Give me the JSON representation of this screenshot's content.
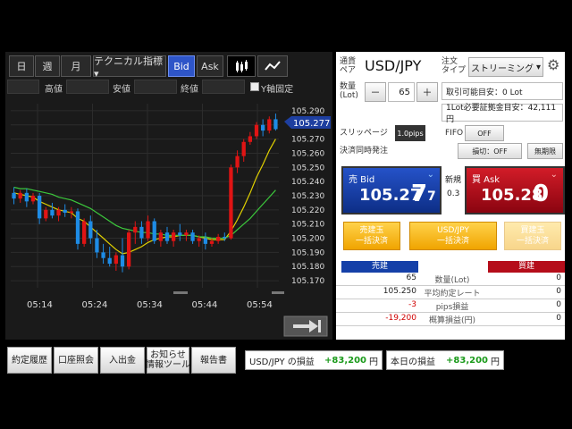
{
  "chart": {
    "toolbar": {
      "day": "日",
      "week": "週",
      "month": "月",
      "technical": "テクニカル指標▾",
      "bid": "Bid",
      "ask": "Ask"
    },
    "ohlc_labels": {
      "high": "高値",
      "low": "安値",
      "close": "終値",
      "yfix": "Y軸固定"
    },
    "current_price_tag": "105.277",
    "next_icon": "next-arrow-icon"
  },
  "chart_data": {
    "type": "candlestick",
    "x_tick_labels": [
      "05:14",
      "05:24",
      "05:34",
      "05:44",
      "05:54"
    ],
    "y_tick_labels": [
      "105.290",
      "105.280",
      "105.270",
      "105.260",
      "105.250",
      "105.240",
      "105.230",
      "105.220",
      "105.210",
      "105.200",
      "105.190",
      "105.180",
      "105.170"
    ],
    "ylim": [
      105.165,
      105.295
    ],
    "candles": [
      {
        "o": 105.232,
        "h": 105.236,
        "l": 105.224,
        "c": 105.228
      },
      {
        "o": 105.228,
        "h": 105.234,
        "l": 105.225,
        "c": 105.232
      },
      {
        "o": 105.232,
        "h": 105.235,
        "l": 105.222,
        "c": 105.226
      },
      {
        "o": 105.226,
        "h": 105.232,
        "l": 105.224,
        "c": 105.23
      },
      {
        "o": 105.23,
        "h": 105.232,
        "l": 105.21,
        "c": 105.214
      },
      {
        "o": 105.214,
        "h": 105.222,
        "l": 105.212,
        "c": 105.22
      },
      {
        "o": 105.22,
        "h": 105.225,
        "l": 105.214,
        "c": 105.216
      },
      {
        "o": 105.216,
        "h": 105.222,
        "l": 105.212,
        "c": 105.22
      },
      {
        "o": 105.22,
        "h": 105.224,
        "l": 105.215,
        "c": 105.218
      },
      {
        "o": 105.218,
        "h": 105.222,
        "l": 105.214,
        "c": 105.219
      },
      {
        "o": 105.219,
        "h": 105.221,
        "l": 105.192,
        "c": 105.196
      },
      {
        "o": 105.196,
        "h": 105.214,
        "l": 105.194,
        "c": 105.212
      },
      {
        "o": 105.212,
        "h": 105.216,
        "l": 105.196,
        "c": 105.2
      },
      {
        "o": 105.2,
        "h": 105.206,
        "l": 105.186,
        "c": 105.19
      },
      {
        "o": 105.19,
        "h": 105.196,
        "l": 105.182,
        "c": 105.186
      },
      {
        "o": 105.186,
        "h": 105.194,
        "l": 105.18,
        "c": 105.182
      },
      {
        "o": 105.182,
        "h": 105.19,
        "l": 105.177,
        "c": 105.188
      },
      {
        "o": 105.188,
        "h": 105.2,
        "l": 105.176,
        "c": 105.18
      },
      {
        "o": 105.18,
        "h": 105.206,
        "l": 105.178,
        "c": 105.204
      },
      {
        "o": 105.204,
        "h": 105.212,
        "l": 105.196,
        "c": 105.208
      },
      {
        "o": 105.208,
        "h": 105.212,
        "l": 105.196,
        "c": 105.2
      },
      {
        "o": 105.2,
        "h": 105.216,
        "l": 105.198,
        "c": 105.212
      },
      {
        "o": 105.212,
        "h": 105.214,
        "l": 105.196,
        "c": 105.198
      },
      {
        "o": 105.198,
        "h": 105.206,
        "l": 105.194,
        "c": 105.204
      },
      {
        "o": 105.204,
        "h": 105.208,
        "l": 105.196,
        "c": 105.198
      },
      {
        "o": 105.198,
        "h": 105.206,
        "l": 105.194,
        "c": 105.204
      },
      {
        "o": 105.204,
        "h": 105.21,
        "l": 105.198,
        "c": 105.202
      },
      {
        "o": 105.202,
        "h": 105.206,
        "l": 105.198,
        "c": 105.204
      },
      {
        "o": 105.204,
        "h": 105.206,
        "l": 105.196,
        "c": 105.198
      },
      {
        "o": 105.198,
        "h": 105.202,
        "l": 105.194,
        "c": 105.2
      },
      {
        "o": 105.2,
        "h": 105.204,
        "l": 105.192,
        "c": 105.196
      },
      {
        "o": 105.196,
        "h": 105.2,
        "l": 105.194,
        "c": 105.198
      },
      {
        "o": 105.198,
        "h": 105.203,
        "l": 105.196,
        "c": 105.201
      },
      {
        "o": 105.201,
        "h": 105.204,
        "l": 105.198,
        "c": 105.2
      },
      {
        "o": 105.2,
        "h": 105.252,
        "l": 105.199,
        "c": 105.25
      },
      {
        "o": 105.25,
        "h": 105.262,
        "l": 105.246,
        "c": 105.258
      },
      {
        "o": 105.258,
        "h": 105.27,
        "l": 105.254,
        "c": 105.268
      },
      {
        "o": 105.268,
        "h": 105.275,
        "l": 105.266,
        "c": 105.272
      },
      {
        "o": 105.272,
        "h": 105.282,
        "l": 105.27,
        "c": 105.28
      },
      {
        "o": 105.28,
        "h": 105.284,
        "l": 105.272,
        "c": 105.276
      },
      {
        "o": 105.276,
        "h": 105.286,
        "l": 105.274,
        "c": 105.284
      },
      {
        "o": 105.284,
        "h": 105.288,
        "l": 105.276,
        "c": 105.277
      }
    ],
    "ma_series": [
      {
        "name": "",
        "color": "#e0d000",
        "values": [
          105.232,
          105.231,
          105.23,
          105.229,
          105.226,
          105.224,
          105.222,
          105.22,
          105.219,
          105.218,
          105.214,
          105.212,
          105.208,
          105.204,
          105.2,
          105.196,
          105.192,
          105.189,
          105.19,
          105.192,
          105.194,
          105.197,
          105.199,
          105.2,
          105.201,
          105.201,
          105.202,
          105.202,
          105.202,
          105.201,
          105.2,
          105.199,
          105.199,
          105.199,
          105.205,
          105.213,
          105.222,
          105.232,
          105.243,
          105.252,
          105.262,
          105.27
        ]
      },
      {
        "name": "",
        "color": "#3cc83c",
        "values": [
          105.236,
          105.235,
          105.235,
          105.234,
          105.233,
          105.232,
          105.231,
          105.229,
          105.228,
          105.227,
          105.225,
          105.223,
          105.221,
          105.218,
          105.215,
          105.212,
          105.209,
          105.207,
          105.206,
          105.205,
          105.204,
          105.204,
          105.203,
          105.203,
          105.202,
          105.202,
          105.202,
          105.202,
          105.202,
          105.201,
          105.201,
          105.2,
          105.2,
          105.2,
          105.202,
          105.206,
          105.21,
          105.214,
          105.219,
          105.224,
          105.229,
          105.234
        ]
      }
    ]
  },
  "order": {
    "pair_label": "通貨\nペア",
    "pair": "USD/JPY",
    "order_type_label": "注文\nタイプ",
    "order_type": "ストリーミング",
    "qty_label": "数量\n(Lot)",
    "qty_minus": "－",
    "qty_value": "65",
    "qty_plus": "＋",
    "available": "取引可能目安：0 Lot",
    "margin": "1Lot必要証拠金目安：42,111円",
    "slippage_label": "スリッページ",
    "slippage_value": "1.0pips",
    "fifo_label": "FIFO",
    "fifo_value": "OFF",
    "settle_label": "決済同時発注",
    "stop_loss": "損切：OFF",
    "no_limit": "無期限",
    "bid_label": "売 Bid",
    "bid_price_main": "105.27",
    "bid_price_big": "7",
    "bid_price_last": "7",
    "spread_label": "新規",
    "spread": "0.3",
    "ask_label": "買 Ask",
    "ask_price_main": "105.28",
    "ask_price_big": "0",
    "sell_settle_1": "売建玉",
    "sell_settle_2": "一括決済",
    "pair_settle_1": "USD/JPY",
    "pair_settle_2": "一括決済",
    "buy_settle_1": "買建玉",
    "buy_settle_2": "一括決済",
    "pos_header_sell": "売建",
    "pos_header_buy": "買建",
    "positions": [
      {
        "sell": "65",
        "label": "数量(Lot)",
        "buy": "0",
        "sell_color": "#222"
      },
      {
        "sell": "105.250",
        "label": "平均約定レート",
        "buy": "0",
        "sell_color": "#222"
      },
      {
        "sell": "-3",
        "label": "pips損益",
        "buy": "0",
        "sell_color": "#d00000"
      },
      {
        "sell": "-19,200",
        "label": "概算損益(円)",
        "buy": "0",
        "sell_color": "#d00000"
      }
    ]
  },
  "bottom": {
    "tabs": [
      "約定履歴",
      "口座照会",
      "入出金",
      "お知らせ\n情報ツール",
      "報告書"
    ],
    "pair_pl_label": "USD/JPY の損益",
    "pair_pl_value": "+83,200",
    "pair_pl_unit": "円",
    "today_pl_label": "本日の損益",
    "today_pl_value": "+83,200",
    "today_pl_unit": "円"
  },
  "colors": {
    "bid_bg": "#1540a8",
    "ask_bg": "#b50d1a",
    "pl_green": "#1a9a1a",
    "up_candle": "#e01414",
    "down_candle": "#1e8ce6"
  }
}
